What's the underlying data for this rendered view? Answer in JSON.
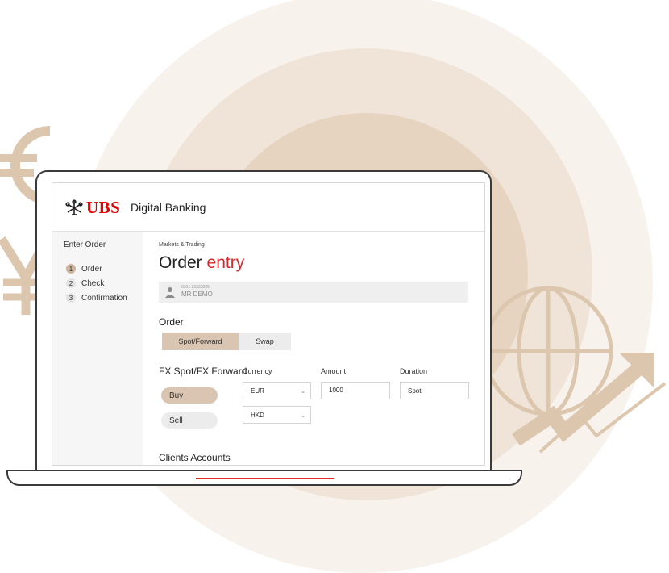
{
  "app": {
    "brand": "UBS",
    "brand_sub": "Digital Banking"
  },
  "sidebar": {
    "title": "Enter Order",
    "steps": [
      {
        "num": "1",
        "label": "Order"
      },
      {
        "num": "2",
        "label": "Check"
      },
      {
        "num": "3",
        "label": "Confirmation"
      }
    ]
  },
  "main": {
    "breadcrumb": "Markets & Trading",
    "title_part1": "Order",
    "title_part2": "entry",
    "client": {
      "id": "0301 23333839",
      "name": "MR DEMO"
    },
    "order_section": "Order",
    "order_types": [
      "Spot/Forward",
      "Swap"
    ],
    "fx_section": "FX Spot/FX Forward",
    "sides": [
      "Buy",
      "Sell"
    ],
    "fields": {
      "currency_label": "Currency",
      "currency_1": "EUR",
      "currency_2": "HKD",
      "amount_label": "Amount",
      "amount_value": "1000",
      "duration_label": "Duration",
      "duration_value": "Spot"
    },
    "clients_section": "Clients Accounts"
  },
  "colors": {
    "accent_red": "#e60000",
    "title_red": "#d12a2a",
    "tan": "#d9c5b2",
    "deco_tan": "#dcc7ae"
  }
}
